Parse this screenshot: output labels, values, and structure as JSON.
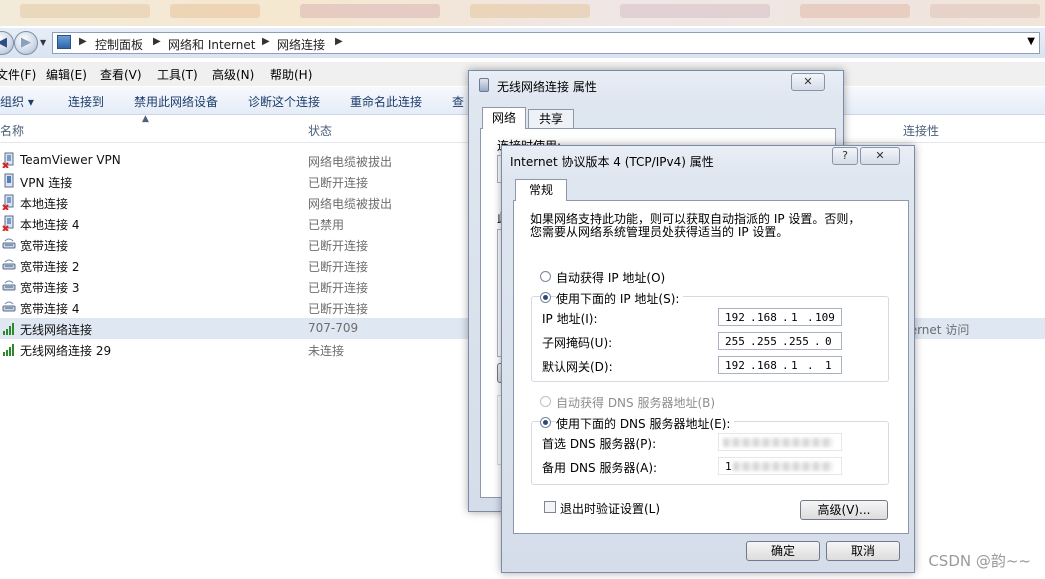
{
  "address_bar": {
    "crumbs": [
      "控制面板",
      "网络和 Internet",
      "网络连接"
    ]
  },
  "menu": [
    "文件(F)",
    "编辑(E)",
    "查看(V)",
    "工具(T)",
    "高级(N)",
    "帮助(H)"
  ],
  "toolbar": {
    "organize": "组织 ▾",
    "connect_to": "连接到",
    "disable": "禁用此网络设备",
    "diagnose": "诊断这个连接",
    "rename": "重命名此连接",
    "more": "查"
  },
  "columns": {
    "name": "名称",
    "status": "状态",
    "connectivity": "连接性"
  },
  "connections": [
    {
      "name": "TeamViewer VPN",
      "status": "网络电缆被拔出",
      "icon": "network-adapter-unplugged-icon"
    },
    {
      "name": "VPN 连接",
      "status": "已断开连接",
      "icon": "vpn-icon"
    },
    {
      "name": "本地连接",
      "status": "网络电缆被拔出",
      "icon": "network-adapter-unplugged-icon"
    },
    {
      "name": "本地连接 4",
      "status": "已禁用",
      "icon": "network-adapter-unplugged-icon"
    },
    {
      "name": "宽带连接",
      "status": "已断开连接",
      "icon": "broadband-icon"
    },
    {
      "name": "宽带连接 2",
      "status": "已断开连接",
      "icon": "broadband-icon"
    },
    {
      "name": "宽带连接 3",
      "status": "已断开连接",
      "icon": "broadband-icon"
    },
    {
      "name": "宽带连接 4",
      "status": "已断开连接",
      "icon": "broadband-icon"
    },
    {
      "name": "无线网络连接",
      "status": "707-709",
      "connectivity": "ternet 访问",
      "icon": "wifi-signal-icon",
      "selected": true
    },
    {
      "name": "无线网络连接 29",
      "status": "未连接",
      "icon": "wifi-signal-icon"
    }
  ],
  "props_dialog": {
    "title": "无线网络连接 属性",
    "tabs": [
      "网络",
      "共享"
    ],
    "connect_using_label": "连接时使用:",
    "partial_char": "此"
  },
  "ipv4_dialog": {
    "title": "Internet 协议版本 4 (TCP/IPv4) 属性",
    "help": "?",
    "tab": "常规",
    "desc_line1": "如果网络支持此功能，则可以获取自动指派的 IP 设置。否则，",
    "desc_line2": "您需要从网络系统管理员处获得适当的 IP 设置。",
    "auto_ip": "自动获得 IP 地址(O)",
    "manual_ip": "使用下面的 IP 地址(S):",
    "ip_label": "IP 地址(I):",
    "ip": [
      "192",
      "168",
      "1",
      "109"
    ],
    "mask_label": "子网掩码(U):",
    "mask": [
      "255",
      "255",
      "255",
      "0"
    ],
    "gw_label": "默认网关(D):",
    "gw": [
      "192",
      "168",
      "1",
      "1"
    ],
    "auto_dns": "自动获得 DNS 服务器地址(B)",
    "manual_dns": "使用下面的 DNS 服务器地址(E):",
    "dns1_label": "首选 DNS 服务器(P):",
    "dns2_label": "备用 DNS 服务器(A):",
    "dns2_partial": "1",
    "validate": "退出时验证设置(L)",
    "advanced": "高级(V)...",
    "ok": "确定",
    "cancel": "取消"
  },
  "watermark": "CSDN @韵~~"
}
